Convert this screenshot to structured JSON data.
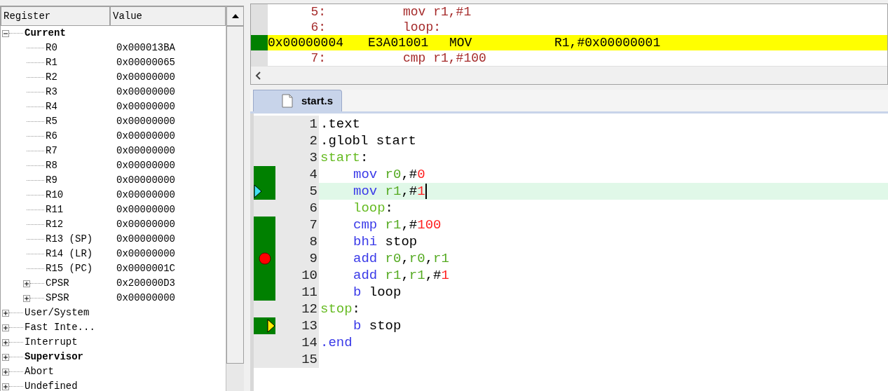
{
  "registers": {
    "columns": [
      "Register",
      "Value"
    ],
    "tree": [
      {
        "label": "Current",
        "bold": true,
        "expanded": true,
        "children": [
          {
            "label": "R0",
            "value": "0x000013BA"
          },
          {
            "label": "R1",
            "value": "0x00000065"
          },
          {
            "label": "R2",
            "value": "0x00000000"
          },
          {
            "label": "R3",
            "value": "0x00000000"
          },
          {
            "label": "R4",
            "value": "0x00000000"
          },
          {
            "label": "R5",
            "value": "0x00000000"
          },
          {
            "label": "R6",
            "value": "0x00000000"
          },
          {
            "label": "R7",
            "value": "0x00000000"
          },
          {
            "label": "R8",
            "value": "0x00000000"
          },
          {
            "label": "R9",
            "value": "0x00000000"
          },
          {
            "label": "R10",
            "value": "0x00000000"
          },
          {
            "label": "R11",
            "value": "0x00000000"
          },
          {
            "label": "R12",
            "value": "0x00000000"
          },
          {
            "label": "R13 (SP)",
            "value": "0x00000000"
          },
          {
            "label": "R14 (LR)",
            "value": "0x00000000"
          },
          {
            "label": "R15 (PC)",
            "value": "0x0000001C"
          },
          {
            "label": "CPSR",
            "value": "0x200000D3",
            "expanded": false
          },
          {
            "label": "SPSR",
            "value": "0x00000000",
            "expanded": false
          }
        ]
      },
      {
        "label": "User/System",
        "bold": false,
        "expanded": false
      },
      {
        "label": "Fast Inte...",
        "bold": false,
        "expanded": false
      },
      {
        "label": "Interrupt",
        "bold": false,
        "expanded": false
      },
      {
        "label": "Supervisor",
        "bold": true,
        "expanded": false
      },
      {
        "label": "Abort",
        "bold": false,
        "expanded": false
      },
      {
        "label": "Undefined",
        "bold": false,
        "expanded": false
      }
    ]
  },
  "disassembly": {
    "lines": [
      {
        "kind": "source",
        "number": "5:",
        "code": "mov r1,#1"
      },
      {
        "kind": "source",
        "number": "6:",
        "code": "loop:"
      },
      {
        "kind": "asm",
        "address": "0x00000004",
        "opcode": "E3A01001",
        "mnemonic": "MOV",
        "operands": "R1,#0x00000001",
        "current": true
      },
      {
        "kind": "source",
        "number": "7:",
        "code": "cmp r1,#100"
      }
    ]
  },
  "editor": {
    "tabs": [
      {
        "label": "start.s",
        "selected": true
      }
    ],
    "lines": [
      {
        "number": "1",
        "executed": false,
        "indent": false,
        "tokens": [
          {
            "kind": "text",
            "text": ".text"
          }
        ]
      },
      {
        "number": "2",
        "executed": false,
        "indent": false,
        "tokens": [
          {
            "kind": "text",
            "text": ".globl start"
          }
        ]
      },
      {
        "number": "3",
        "executed": false,
        "indent": false,
        "tokens": [
          {
            "kind": "label",
            "text": "start"
          },
          {
            "kind": "text",
            "text": ":"
          }
        ]
      },
      {
        "number": "4",
        "executed": true,
        "indent": true,
        "tokens": [
          {
            "kind": "instr",
            "text": "mov"
          },
          {
            "kind": "reg",
            "text": "r0",
            "spaced": true
          },
          {
            "kind": "text",
            "text": ",#"
          },
          {
            "kind": "num",
            "text": "0"
          }
        ]
      },
      {
        "number": "5",
        "executed": true,
        "current_line": true,
        "highlighted": true,
        "cursor": true,
        "indent": true,
        "tokens": [
          {
            "kind": "instr",
            "text": "mov"
          },
          {
            "kind": "reg",
            "text": "r1",
            "spaced": true
          },
          {
            "kind": "text",
            "text": ",#"
          },
          {
            "kind": "num",
            "text": "1"
          }
        ]
      },
      {
        "number": "6",
        "executed": false,
        "indent": true,
        "tokens": [
          {
            "kind": "label",
            "text": "loop"
          },
          {
            "kind": "text",
            "text": ":"
          }
        ]
      },
      {
        "number": "7",
        "executed": true,
        "indent": true,
        "tokens": [
          {
            "kind": "instr",
            "text": "cmp"
          },
          {
            "kind": "reg",
            "text": "r1",
            "spaced": true
          },
          {
            "kind": "text",
            "text": ",#"
          },
          {
            "kind": "num",
            "text": "100"
          }
        ]
      },
      {
        "number": "8",
        "executed": true,
        "indent": true,
        "tokens": [
          {
            "kind": "instr",
            "text": "bhi"
          },
          {
            "kind": "text",
            "text": "stop",
            "spaced": true
          }
        ]
      },
      {
        "number": "9",
        "executed": true,
        "breakpoint": true,
        "indent": true,
        "tokens": [
          {
            "kind": "instr",
            "text": "add"
          },
          {
            "kind": "reg",
            "text": "r0",
            "spaced": true
          },
          {
            "kind": "text",
            "text": ","
          },
          {
            "kind": "reg",
            "text": "r0"
          },
          {
            "kind": "text",
            "text": ","
          },
          {
            "kind": "reg",
            "text": "r1"
          }
        ]
      },
      {
        "number": "10",
        "executed": true,
        "indent": true,
        "tokens": [
          {
            "kind": "instr",
            "text": "add"
          },
          {
            "kind": "reg",
            "text": "r1",
            "spaced": true
          },
          {
            "kind": "text",
            "text": ","
          },
          {
            "kind": "reg",
            "text": "r1"
          },
          {
            "kind": "text",
            "text": ",#"
          },
          {
            "kind": "num",
            "text": "1"
          }
        ]
      },
      {
        "number": "11",
        "executed": true,
        "indent": true,
        "tokens": [
          {
            "kind": "instr",
            "text": "b"
          },
          {
            "kind": "text",
            "text": "loop",
            "spaced": true
          }
        ]
      },
      {
        "number": "12",
        "executed": false,
        "indent": false,
        "tokens": [
          {
            "kind": "label",
            "text": "stop"
          },
          {
            "kind": "text",
            "text": ":"
          }
        ]
      },
      {
        "number": "13",
        "executed": true,
        "call_stack": true,
        "indent": true,
        "tokens": [
          {
            "kind": "instr",
            "text": "b"
          },
          {
            "kind": "text",
            "text": "stop",
            "spaced": true
          }
        ]
      },
      {
        "number": "14",
        "executed": false,
        "indent": false,
        "tokens": [
          {
            "kind": "instr",
            "text": ".end"
          }
        ]
      },
      {
        "number": "15",
        "executed": false
      }
    ]
  }
}
